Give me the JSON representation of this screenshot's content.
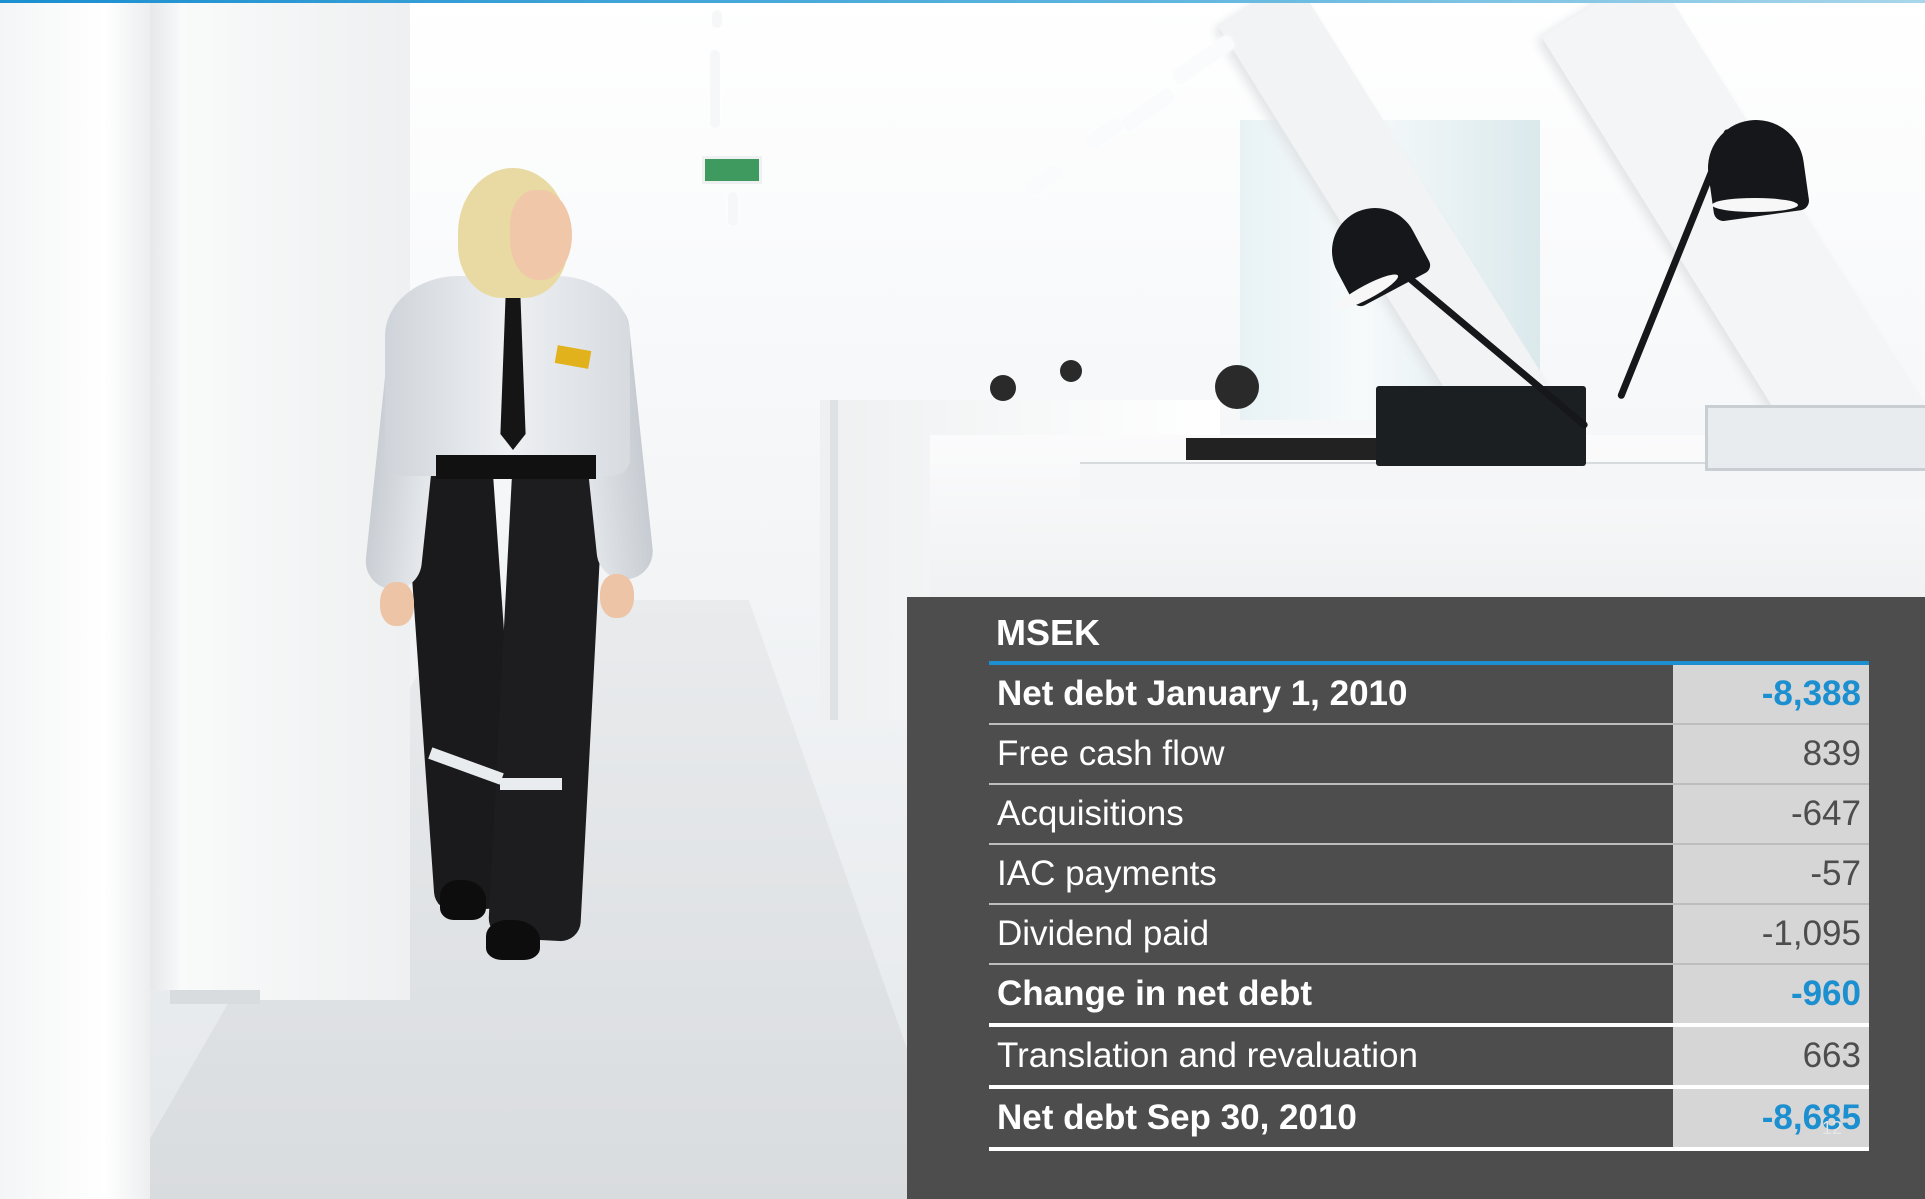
{
  "table": {
    "header": "MSEK",
    "rows": [
      {
        "label": "Net debt January 1, 2010",
        "value": "-8,388"
      },
      {
        "label": "Free cash flow",
        "value": "839"
      },
      {
        "label": "Acquisitions",
        "value": "-647"
      },
      {
        "label": "IAC payments",
        "value": "-57"
      },
      {
        "label": "Dividend paid",
        "value": "-1,095"
      },
      {
        "label": "Change in net debt",
        "value": "-960"
      },
      {
        "label": "Translation and revaluation",
        "value": "663"
      },
      {
        "label": "Net debt Sep 30, 2010",
        "value": "-8,685"
      }
    ]
  },
  "page_number": "12",
  "colors": {
    "accent": "#1b8fd0",
    "panel": "#4d4d4d",
    "value_cell": "#d6d6d6"
  }
}
